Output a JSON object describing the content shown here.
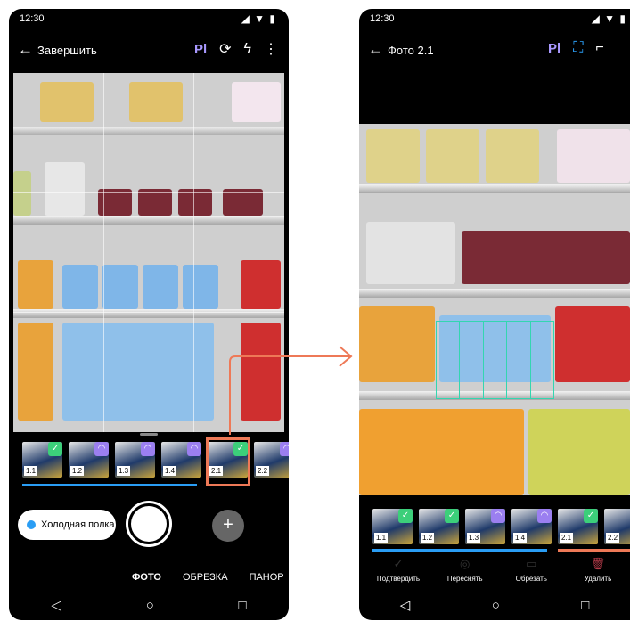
{
  "left": {
    "status": {
      "time": "12:30"
    },
    "header": {
      "back_label": "Завершить"
    },
    "toolbar": {
      "logo": "Pl"
    },
    "thumbnails": [
      {
        "label": "1.1",
        "state": "ok"
      },
      {
        "label": "1.2",
        "state": "pending"
      },
      {
        "label": "1.3",
        "state": "pending"
      },
      {
        "label": "1.4",
        "state": "pending"
      },
      {
        "label": "2.1",
        "state": "ok"
      },
      {
        "label": "2.2",
        "state": "pending"
      }
    ],
    "category_chip": "Холодная полка",
    "add_label": "+",
    "modes": [
      "ФОТО",
      "ОБРЕЗКА",
      "ПАНОР"
    ]
  },
  "right": {
    "status": {
      "time": "12:30"
    },
    "header": {
      "back_label": "Фото 2.1"
    },
    "toolbar": {
      "logo": "Pl"
    },
    "thumbnails": [
      {
        "label": "1.1",
        "state": "ok"
      },
      {
        "label": "1.2",
        "state": "ok"
      },
      {
        "label": "1.3",
        "state": "pending"
      },
      {
        "label": "1.4",
        "state": "pending"
      },
      {
        "label": "2.1",
        "state": "ok"
      },
      {
        "label": "2.2",
        "state": "pending"
      }
    ],
    "actions": [
      "Подтвердить",
      "Переснять",
      "Обрезать",
      "Удалить"
    ]
  },
  "colors": {
    "accent": "#2a9df4",
    "highlight": "#ee7957",
    "ok": "#3ccf7a",
    "pending": "#9b7ff0",
    "logo": "#a999ff"
  }
}
